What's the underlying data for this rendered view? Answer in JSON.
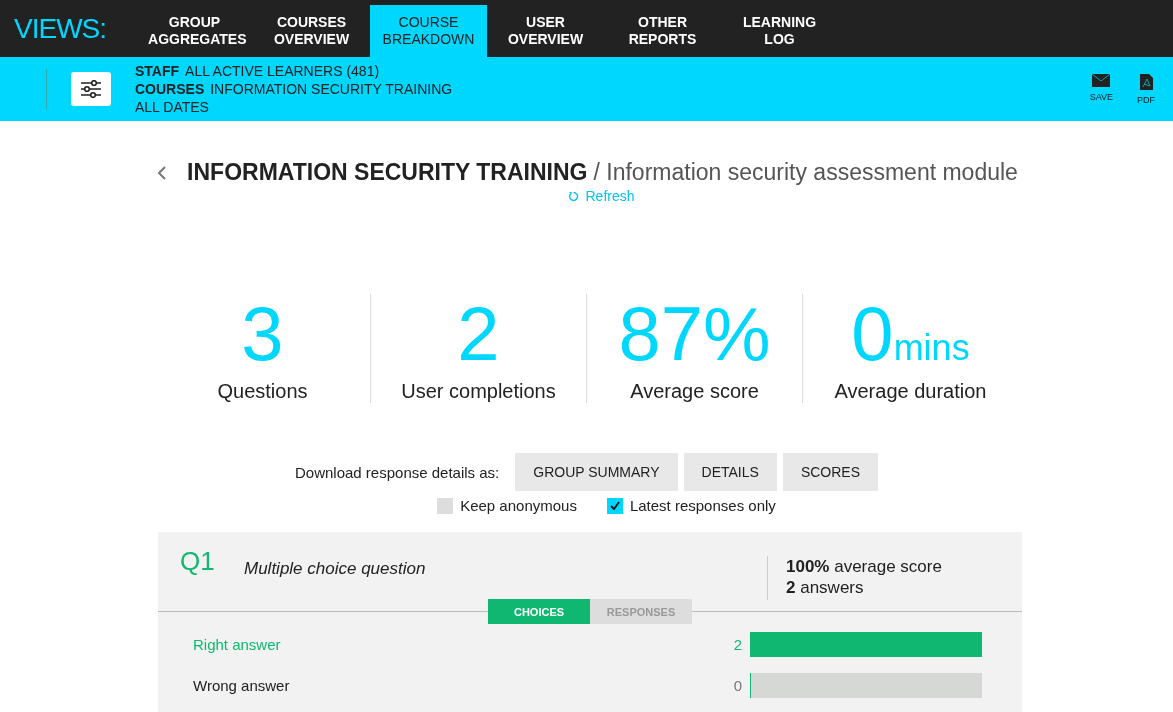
{
  "nav": {
    "label": "VIEWS:",
    "tabs": [
      {
        "label": "GROUP AGGREGATES",
        "selected": false
      },
      {
        "label": "COURSES OVERVIEW",
        "selected": false
      },
      {
        "label": "COURSE BREAKDOWN",
        "selected": true
      },
      {
        "label": "USER OVERVIEW",
        "selected": false
      },
      {
        "label": "OTHER REPORTS",
        "selected": false
      },
      {
        "label": "LEARNING LOG",
        "selected": false
      }
    ]
  },
  "filters": {
    "lines": [
      {
        "key": "STAFF",
        "value": "ALL ACTIVE LEARNERS (481)"
      },
      {
        "key": "COURSES",
        "value": "INFORMATION SECURITY TRAINING"
      },
      {
        "value": "ALL DATES"
      }
    ],
    "actions": [
      {
        "kind": "mail",
        "label": "SAVE"
      },
      {
        "kind": "pdf",
        "label": "PDF"
      }
    ]
  },
  "heading": {
    "course": "INFORMATION SECURITY TRAINING",
    "module": "/ Information security assessment module",
    "refresh": "Refresh"
  },
  "stats": [
    {
      "value": "3",
      "label": "Questions"
    },
    {
      "value": "2",
      "label": "User completions"
    },
    {
      "value": "87%",
      "label": "Average score"
    },
    {
      "value": "0",
      "unit": "mins",
      "label": "Average duration"
    }
  ],
  "download": {
    "label": "Download response details as:",
    "buttons": [
      "GROUP SUMMARY",
      "DETAILS",
      "SCORES"
    ],
    "options": [
      {
        "label": "Keep anonymous",
        "checked": false
      },
      {
        "label": "Latest responses only",
        "checked": true
      }
    ]
  },
  "question": {
    "number": "Q1",
    "type": "Multiple choice question",
    "summary": [
      "**100%** average score",
      "**2** answers"
    ],
    "tabs": [
      {
        "label": "CHOICES",
        "selected": true
      },
      {
        "label": "RESPONSES",
        "selected": false
      }
    ],
    "answers": [
      {
        "text": "Right answer",
        "correct": true,
        "count": "2",
        "level": 1
      },
      {
        "text": "Wrong answer",
        "correct": false,
        "count": "0",
        "level": 0
      }
    ]
  }
}
